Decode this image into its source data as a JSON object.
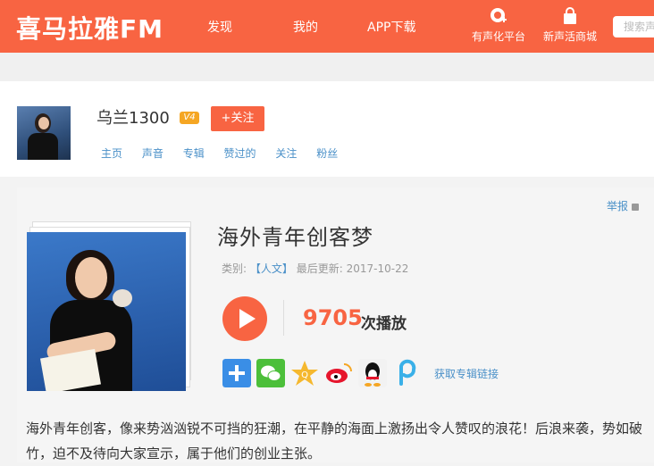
{
  "nav": {
    "logo": "喜马拉雅FM",
    "items": [
      "发现",
      "我的",
      "APP下载"
    ],
    "icon_items": [
      {
        "label": "有声化平台",
        "icon": "plus-badge-icon"
      },
      {
        "label": "新声活商城",
        "icon": "shopping-bag-icon"
      }
    ],
    "search_placeholder": "搜索声"
  },
  "profile": {
    "username": "乌兰1300",
    "level_badge": "V4",
    "follow_label": "+关注",
    "tabs": [
      "主页",
      "声音",
      "专辑",
      "赞过的",
      "关注",
      "粉丝"
    ]
  },
  "album": {
    "report_label": "举报",
    "title": "海外青年创客梦",
    "category_label": "类别:",
    "category": "【人文】",
    "updated_label": "最后更新:",
    "updated": "2017-10-22",
    "play_count": "9705",
    "play_count_label": "次播放",
    "share_icons": [
      "plus-share-icon",
      "wechat-icon",
      "qzone-icon",
      "weibo-icon",
      "qq-icon",
      "p-share-icon"
    ],
    "share_link_label": "获取专辑链接",
    "description": "海外青年创客，像来势汹汹锐不可挡的狂潮，在平静的海面上激扬出令人赞叹的浪花！后浪来袭，势如破竹，迫不及待向大家宣示，属于他们的创业主张。"
  },
  "colors": {
    "brand": "#f86442",
    "link": "#4a90c8"
  }
}
